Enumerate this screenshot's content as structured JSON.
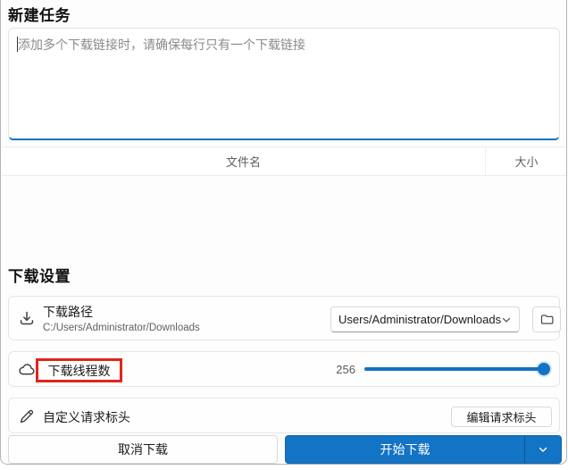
{
  "window": {
    "title_new_task": "新建任务",
    "title_settings": "下载设置"
  },
  "new_task": {
    "input_value": "",
    "input_placeholder": "添加多个下载链接时，请确保每行只有一个下载链接"
  },
  "file_table": {
    "columns": {
      "filename": "文件名",
      "size": "大小"
    },
    "rows": []
  },
  "settings": {
    "download_path": {
      "icon": "download-icon",
      "title": "下载路径",
      "subtitle": "C:/Users/Administrator/Downloads",
      "combo_value": "Users/Administrator/Downloads",
      "folder_button_icon": "folder-icon"
    },
    "thread_count": {
      "icon": "cloud-icon",
      "title": "下载线程数",
      "value": "256",
      "slider_percent": 100,
      "annotation_highlight": true
    },
    "request_headers": {
      "icon": "pencil-icon",
      "title": "自定义请求标头",
      "button_label": "编辑请求标头"
    }
  },
  "footer": {
    "cancel_label": "取消下载",
    "start_label": "开始下载",
    "start_menu_icon": "chevron-down-icon"
  },
  "colors": {
    "accent": "#1373c4",
    "annotation_red": "#e1251b"
  }
}
